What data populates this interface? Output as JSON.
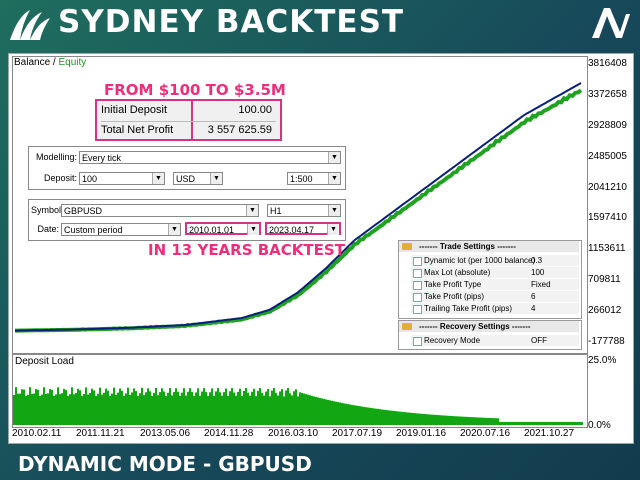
{
  "banner": {
    "title": "SYDNEY BACKTEST",
    "footer": "DYNAMIC MODE - GBPUSD"
  },
  "headline": {
    "top": "FROM $100 TO $3.5M",
    "middle": "IN 13 YEARS BACKTEST"
  },
  "legend": {
    "balance": "Balance",
    "sep": " / ",
    "equity": "Equity"
  },
  "deposit_box": {
    "initial_label": "Initial Deposit",
    "initial_value": "100.00",
    "profit_label": "Total Net Profit",
    "profit_value": "3 557 625.59"
  },
  "settings1": {
    "modelling_label": "Modelling:",
    "modelling_value": "Every tick",
    "deposit_label": "Deposit:",
    "deposit_value": "100",
    "currency": "USD",
    "leverage": "1:500"
  },
  "settings2": {
    "symbol_label": "Symbol:",
    "symbol_value": "GBPUSD",
    "timeframe": "H1",
    "date_label": "Date:",
    "date_mode": "Custom period",
    "date_from": "2010.01.01",
    "date_to": "2023.04.17"
  },
  "trade_settings": {
    "title": "------- Trade Settings -------",
    "items": [
      {
        "name": "Dynamic lot (per 1000 balance)",
        "value": "0.3"
      },
      {
        "name": "Max Lot (absolute)",
        "value": "100"
      },
      {
        "name": "Take Profit Type",
        "value": "Fixed"
      },
      {
        "name": "Take Profit (pips)",
        "value": "6"
      },
      {
        "name": "Trailing Take Profit (pips)",
        "value": "4"
      }
    ]
  },
  "recovery_settings": {
    "title": "------- Recovery Settings -------",
    "items": [
      {
        "name": "Recovery Mode",
        "value": "OFF"
      }
    ]
  },
  "load": {
    "label": "Deposit Load",
    "max": "25.0%",
    "min": "0.0%"
  },
  "colors": {
    "balance": "#0a1f7a",
    "equity": "#1fa31f",
    "accent": "#ee2d7b",
    "load": "#12a612"
  },
  "chart_data": {
    "type": "line",
    "y_ticks": [
      "3816408",
      "3372658",
      "2928809",
      "2485005",
      "2041210",
      "1597410",
      "1153611",
      "709811",
      "266012",
      "-177788"
    ],
    "x_ticks": [
      "2010.02.11",
      "2011.11.21",
      "2013.05.06",
      "2014.11.28",
      "2016.03.10",
      "2017.07.19",
      "2019.01.16",
      "2020.07.16",
      "2021.10.27"
    ],
    "ylim": [
      -177788,
      3816408
    ],
    "series": [
      {
        "name": "Balance",
        "x": [
          0,
          0.1,
          0.2,
          0.3,
          0.4,
          0.45,
          0.5,
          0.55,
          0.6,
          0.7,
          0.8,
          0.9,
          1.0
        ],
        "y": [
          100,
          15000,
          40000,
          80000,
          180000,
          300000,
          550000,
          900000,
          1300000,
          1900000,
          2500000,
          3100000,
          3557725
        ]
      },
      {
        "name": "Equity",
        "x": [
          0,
          0.1,
          0.2,
          0.3,
          0.4,
          0.45,
          0.5,
          0.55,
          0.6,
          0.7,
          0.8,
          0.9,
          1.0
        ],
        "y": [
          100,
          14000,
          38000,
          76000,
          170000,
          285000,
          520000,
          860000,
          1250000,
          1840000,
          2430000,
          3020000,
          3480000
        ]
      }
    ]
  }
}
